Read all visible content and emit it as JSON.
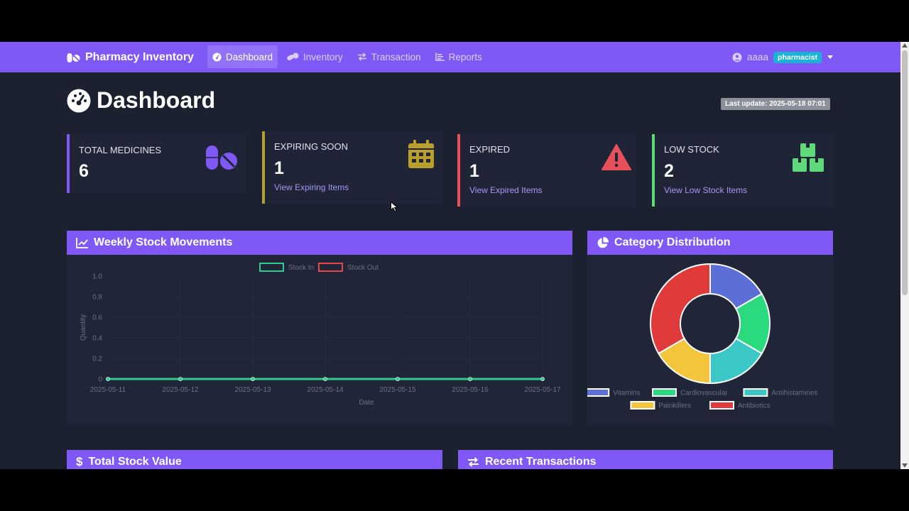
{
  "app": {
    "brand": "Pharmacy Inventory"
  },
  "nav": [
    {
      "label": "Dashboard",
      "icon": "dashboard-icon",
      "active": true
    },
    {
      "label": "Inventory",
      "icon": "pills-icon"
    },
    {
      "label": "Transaction",
      "icon": "exchange-icon"
    },
    {
      "label": "Reports",
      "icon": "chart-bar-icon"
    }
  ],
  "user": {
    "name": "aaaa",
    "role": "pharmacist"
  },
  "page": {
    "title": "Dashboard",
    "last_update": "Last update: 2025-05-18 07:01"
  },
  "cards": [
    {
      "label": "Total Medicines",
      "value": "6",
      "link": "",
      "accent": "#8058f5",
      "icon": "pills-icon"
    },
    {
      "label": "Expiring Soon",
      "value": "1",
      "link": "View Expiring Items",
      "accent": "#b8a02a",
      "icon": "calendar-icon"
    },
    {
      "label": "Expired",
      "value": "1",
      "link": "View Expired Items",
      "accent": "#e8505b",
      "icon": "warning-icon"
    },
    {
      "label": "Low Stock",
      "value": "2",
      "link": "View Low Stock Items",
      "accent": "#5fd97a",
      "icon": "boxes-icon"
    }
  ],
  "panels": {
    "weekly": "Weekly Stock Movements",
    "category": "Category Distribution",
    "stock_value": "Total Stock Value",
    "recent": "Recent Transactions"
  },
  "chart_data": [
    {
      "type": "line",
      "x": [
        "2025-05-11",
        "2025-05-12",
        "2025-05-13",
        "2025-05-14",
        "2025-05-15",
        "2025-05-16",
        "2025-05-17"
      ],
      "series": [
        {
          "name": "Stock In",
          "values": [
            0,
            0,
            0,
            0,
            0,
            0,
            0
          ],
          "color": "#2ecc8f"
        },
        {
          "name": "Stock Out",
          "values": [
            0,
            0,
            0,
            0,
            0,
            0,
            0
          ],
          "color": "#e24a4a"
        }
      ],
      "xlabel": "Date",
      "ylabel": "Quantity",
      "yticks": [
        "1.0",
        "0.8",
        "0.6",
        "0.4",
        "0.2",
        "0"
      ],
      "ylim": [
        0,
        1
      ],
      "legend": "top"
    },
    {
      "type": "pie",
      "categories": [
        "Vitamins",
        "Cardiovascular",
        "Antihistamines",
        "Painkillers",
        "Antibiotics"
      ],
      "values": [
        1,
        1,
        1,
        1,
        2
      ],
      "colors": [
        "#5b6fd6",
        "#2bd97f",
        "#3cc7c7",
        "#f2c53d",
        "#e03a3a"
      ],
      "legend": "bottom"
    }
  ]
}
